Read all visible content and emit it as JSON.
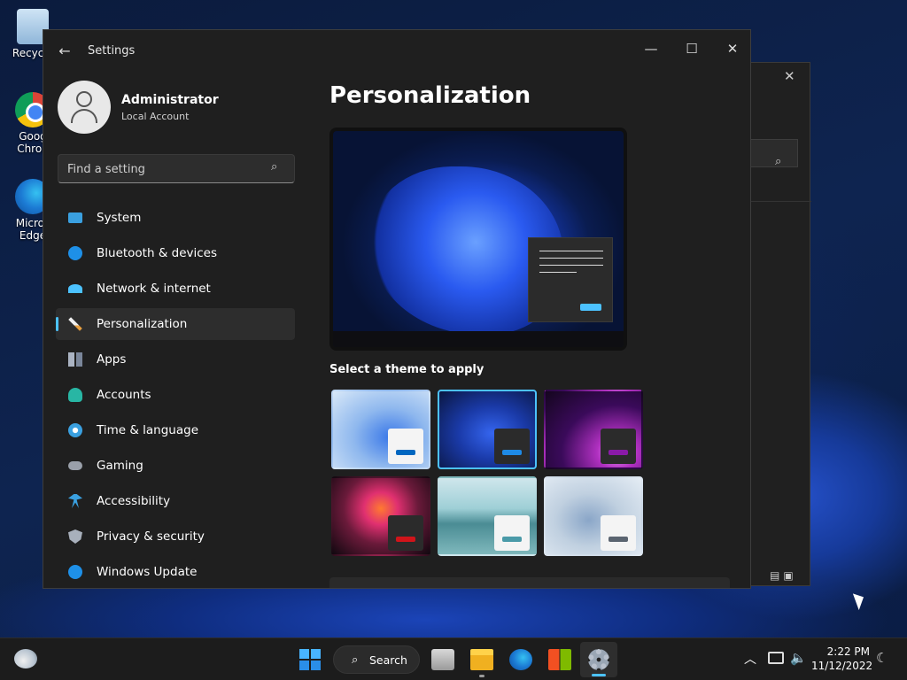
{
  "desktop": {
    "icons": [
      {
        "label": "Recycle"
      },
      {
        "label": "Goog Chron"
      },
      {
        "label": "Micros Edge"
      }
    ]
  },
  "window": {
    "title": "Settings",
    "back_icon": "back-arrow-icon",
    "minimize_glyph": "—",
    "maximize_glyph": "☐",
    "close_glyph": "✕"
  },
  "profile": {
    "name": "Administrator",
    "account_type": "Local Account"
  },
  "search": {
    "placeholder": "Find a setting"
  },
  "nav": {
    "items": [
      {
        "label": "System",
        "icon": "monitor-icon",
        "active": false
      },
      {
        "label": "Bluetooth & devices",
        "icon": "bluetooth-icon",
        "active": false
      },
      {
        "label": "Network & internet",
        "icon": "wifi-icon",
        "active": false
      },
      {
        "label": "Personalization",
        "icon": "brush-icon",
        "active": true
      },
      {
        "label": "Apps",
        "icon": "apps-icon",
        "active": false
      },
      {
        "label": "Accounts",
        "icon": "person-icon",
        "active": false
      },
      {
        "label": "Time & language",
        "icon": "globe-clock-icon",
        "active": false
      },
      {
        "label": "Gaming",
        "icon": "gamepad-icon",
        "active": false
      },
      {
        "label": "Accessibility",
        "icon": "accessibility-icon",
        "active": false
      },
      {
        "label": "Privacy & security",
        "icon": "shield-icon",
        "active": false
      },
      {
        "label": "Windows Update",
        "icon": "update-icon",
        "active": false
      }
    ]
  },
  "content": {
    "title": "Personalization",
    "themes_label": "Select a theme to apply",
    "selected_theme_index": 1,
    "accent_color": "#4cc2ff"
  },
  "taskbar": {
    "search_label": "Search",
    "clock_time": "2:22 PM",
    "clock_date": "11/12/2022"
  }
}
